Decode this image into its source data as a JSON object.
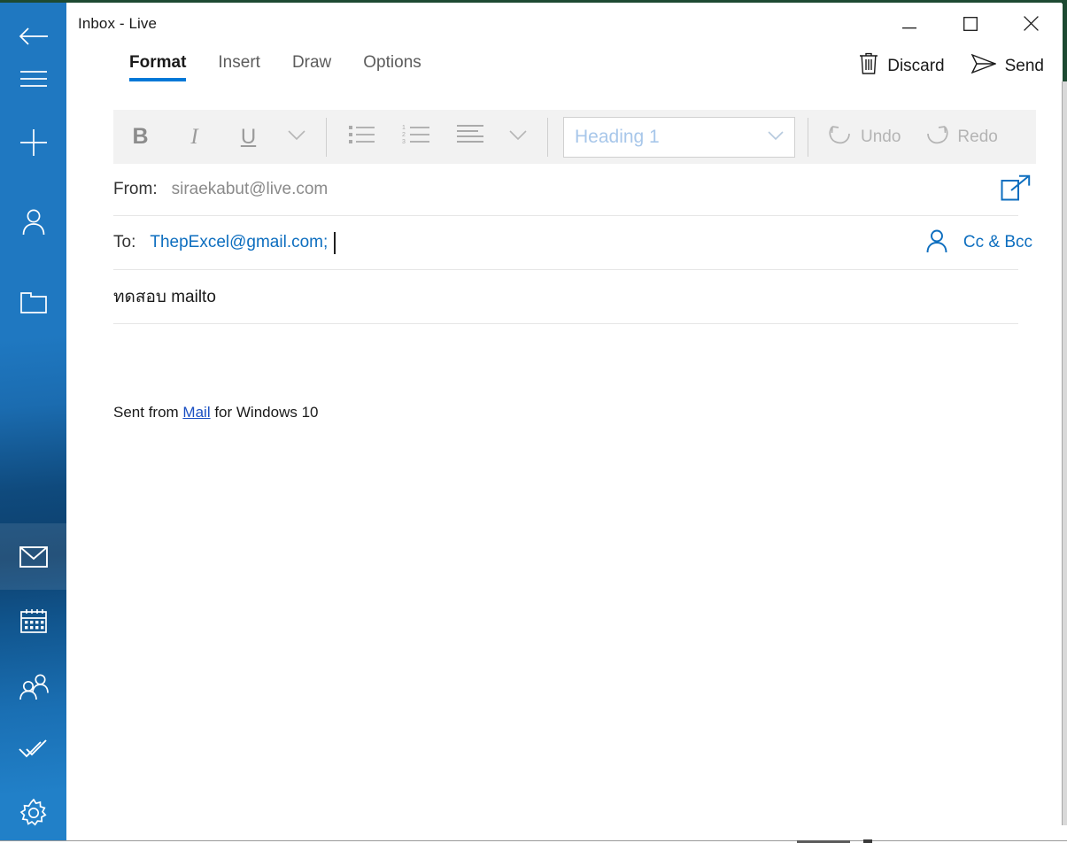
{
  "window": {
    "title": "Inbox - Live",
    "controls": [
      {
        "name": "minimize",
        "glyph": "—"
      },
      {
        "name": "maximize",
        "glyph": "□"
      },
      {
        "name": "close",
        "glyph": "✕"
      }
    ]
  },
  "sidebar": {
    "items": [
      {
        "name": "back",
        "icon": "back-arrow-icon",
        "selected": false
      },
      {
        "name": "menu",
        "icon": "hamburger-menu-icon",
        "selected": false
      },
      {
        "name": "new-mail",
        "icon": "plus-icon",
        "selected": false
      },
      {
        "name": "accounts",
        "icon": "person-icon",
        "selected": false
      },
      {
        "name": "folders",
        "icon": "folder-icon",
        "selected": false
      },
      {
        "name": "mail",
        "icon": "envelope-icon",
        "selected": true
      },
      {
        "name": "calendar",
        "icon": "calendar-icon",
        "selected": false
      },
      {
        "name": "people",
        "icon": "people-icon",
        "selected": false
      },
      {
        "name": "tasks",
        "icon": "checkmark-icon",
        "selected": false
      },
      {
        "name": "settings",
        "icon": "gear-icon",
        "selected": false
      }
    ]
  },
  "ribbon": {
    "tabs": [
      {
        "label": "Format",
        "active": true
      },
      {
        "label": "Insert",
        "active": false
      },
      {
        "label": "Draw",
        "active": false
      },
      {
        "label": "Options",
        "active": false
      }
    ],
    "discard_label": "Discard",
    "send_label": "Send",
    "discard_icon": "trash-icon",
    "send_icon": "send-arrow-icon"
  },
  "toolbar": {
    "bold_label": "B",
    "italic_label": "I",
    "underline_label": "U",
    "font_more_icon": "chevron-down-icon",
    "bullet_list_icon": "bullet-list-icon",
    "numbered_list_icon": "numbered-list-icon",
    "align_icon": "align-left-icon",
    "align_more_icon": "chevron-down-icon",
    "style_value": "Heading 1",
    "style_chevron_icon": "chevron-down-icon",
    "undo_label": "Undo",
    "redo_label": "Redo",
    "undo_icon": "undo-arrow-icon",
    "redo_icon": "redo-arrow-icon",
    "numbered_list_digits": [
      "1",
      "2",
      "3"
    ]
  },
  "compose": {
    "from_label": "From:",
    "from_value": "siraekabut@live.com",
    "to_label": "To:",
    "to_value": "ThepExcel@gmail.com;",
    "cc_bcc_label": "Cc & Bcc",
    "contacts_icon": "person-icon",
    "popout_icon": "open-in-new-window-icon",
    "subject_value": "ทดสอบ mailto",
    "body_prefix": "Sent from ",
    "body_link": "Mail",
    "body_suffix": " for Windows 10"
  },
  "colors": {
    "accent": "#0078d7",
    "sidebar_blue": "#1f78c1",
    "link_blue": "#0d6ebf",
    "toolbar_bg": "#f2f2f2"
  }
}
